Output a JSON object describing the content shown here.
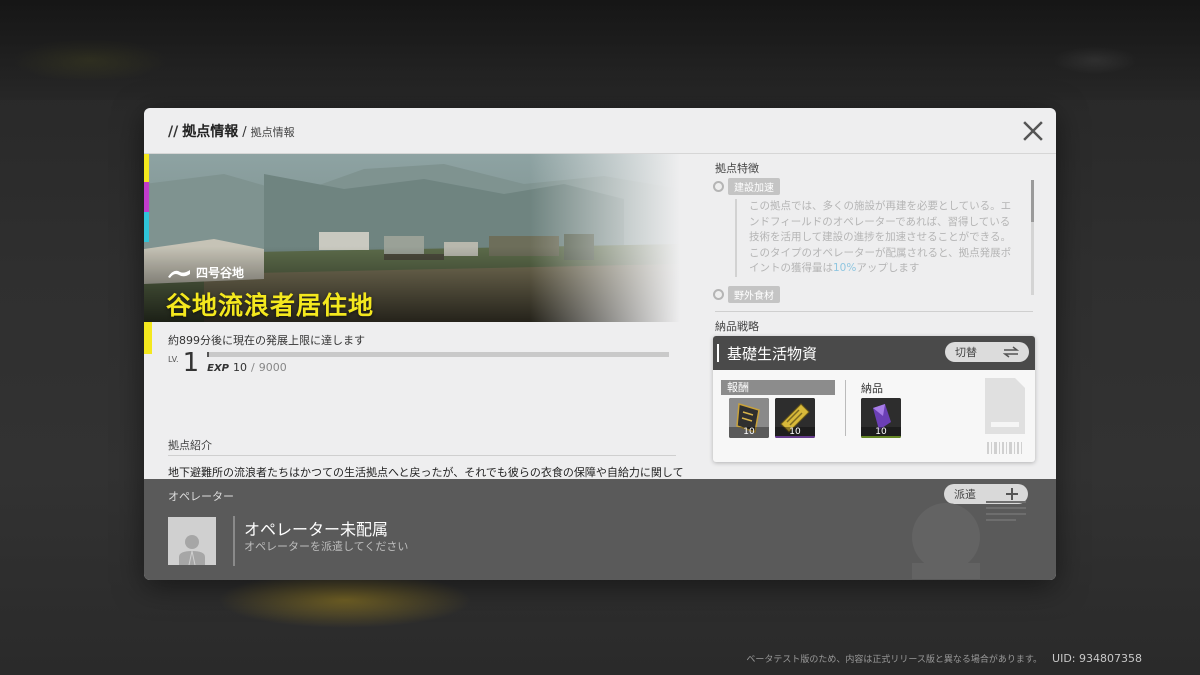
{
  "breadcrumb": {
    "slashes": "//",
    "main": "拠点情報",
    "separator": "/",
    "sub": "拠点情報"
  },
  "settlement": {
    "region": "四号谷地",
    "name": "谷地流浪者居住地",
    "development_text": "約899分後に現在の発展上限に達します",
    "level_label": "LV.",
    "level": "1",
    "exp_label": "EXP",
    "exp_current": "10",
    "exp_separator": "/",
    "exp_max": "9000",
    "exp_fraction": 0.0011
  },
  "intro": {
    "title": "拠点紹介",
    "text": "地下避難所の流浪者たちはかつての生活拠点へと戻ったが、それでも彼らの衣食の保障や自給力に関してはまだ楽観視できないようだ。"
  },
  "features": {
    "title": "拠点特徴",
    "items": [
      {
        "label": "建設加速"
      },
      {
        "label": "野外食材"
      }
    ],
    "description_main": "この拠点では、多くの施設が再建を必要としている。エンドフィールドのオペレーターであれば、習得している技術を活用して建設の進捗を加速させることができる。このタイプのオペレーターが配属されると、拠点発展ポイントの獲得量は",
    "description_highlight": "10%",
    "description_end": "アップします"
  },
  "strategy": {
    "title": "納品戦略",
    "card_title": "基礎生活物資",
    "switch_label": "切替",
    "reward_label": "報酬",
    "deliver_label": "納品",
    "reward_items": [
      {
        "qty": "10",
        "icon": "tactical-item-icon"
      },
      {
        "qty": "10",
        "icon": "ticket-item-icon"
      }
    ],
    "deliver_items": [
      {
        "qty": "10",
        "icon": "crystal-item-icon"
      }
    ]
  },
  "operator": {
    "title": "オペレーター",
    "dispatch_label": "派遣",
    "name": "オペレーター未配属",
    "hint": "オペレーターを派遣してください"
  },
  "footer": {
    "note": "ベータテスト版のため、内容は正式リリース版と異なる場合があります。",
    "uid": "UID: 934807358"
  },
  "colors": {
    "accent_yellow": "#f4e81e",
    "magenta": "#c13ccb",
    "cyan": "#2fc4d9",
    "highlight_blue": "#8fc6e0"
  }
}
